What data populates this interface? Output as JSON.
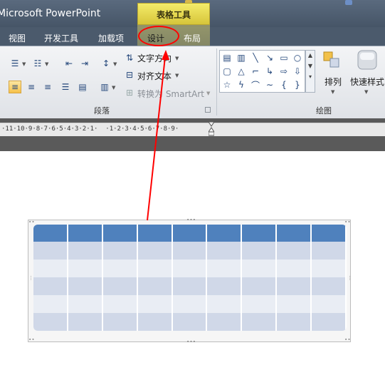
{
  "window": {
    "app_title": "Microsoft PowerPoint"
  },
  "contextual_tab": {
    "title": "表格工具"
  },
  "tabs": [
    {
      "label": "视图"
    },
    {
      "label": "开发工具"
    },
    {
      "label": "加载项"
    },
    {
      "label": "设计",
      "selected": true
    },
    {
      "label": "布局"
    }
  ],
  "ribbon": {
    "paragraph_group": {
      "label": "段落",
      "text_direction": "文字方向",
      "align_text": "对齐文本",
      "convert_smartart": "转换为 SmartArt",
      "icons": [
        "bullets-icon",
        "numbering-icon",
        "decrease-indent-icon",
        "increase-indent-icon",
        "line-spacing-icon",
        "align-left-icon",
        "align-center-icon",
        "align-right-icon",
        "justify-icon",
        "distributed-icon",
        "columns-icon"
      ]
    },
    "drawing_group": {
      "label": "绘图",
      "arrange": "排列",
      "quick_styles": "快速样式"
    }
  },
  "ruler": {
    "text": "·11·10·9·8·7·6·5·4·3·2·1·  ·1·2·3·4·5·6·7·8·9·"
  },
  "table": {
    "rows": 6,
    "columns": 9,
    "header_color": "#4f81bd",
    "band1_color": "#d0d8e8",
    "band2_color": "#e9edf4"
  },
  "annotation": {
    "color": "#ff0000"
  }
}
